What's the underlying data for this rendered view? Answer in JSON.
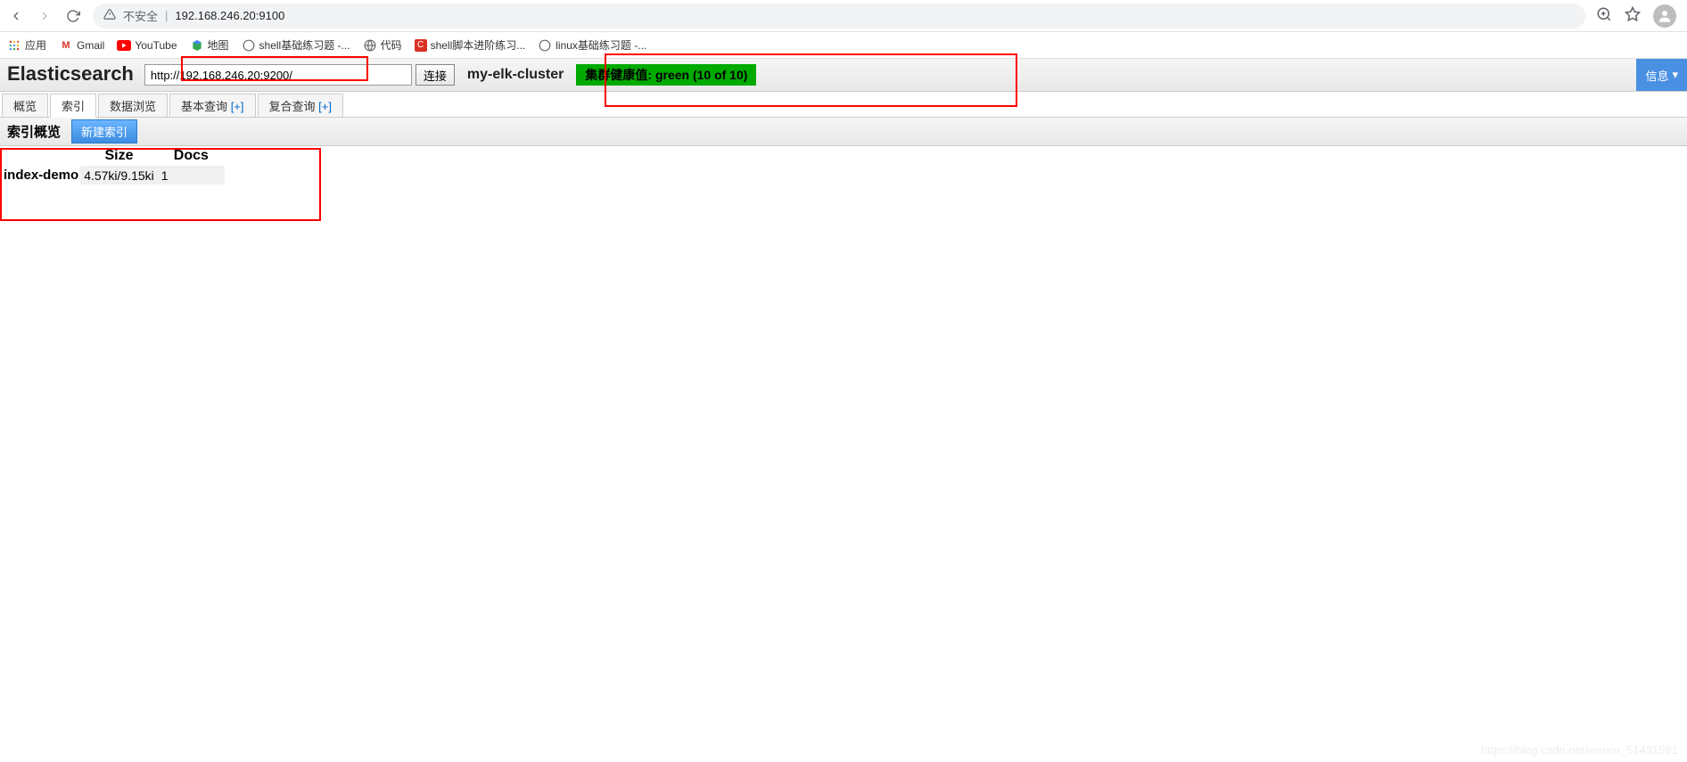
{
  "browser": {
    "url_security": "不安全",
    "url": "192.168.246.20:9100"
  },
  "bookmarks": {
    "apps": "应用",
    "items": [
      {
        "label": "Gmail"
      },
      {
        "label": "YouTube"
      },
      {
        "label": "地图"
      },
      {
        "label": "shell基础练习题 -..."
      },
      {
        "label": "代码"
      },
      {
        "label": "shell脚本进阶练习..."
      },
      {
        "label": "linux基础练习题 -..."
      }
    ]
  },
  "es": {
    "logo": "Elasticsearch",
    "url_value": "http://192.168.246.20:9200/",
    "connect": "连接",
    "cluster_name": "my-elk-cluster",
    "health_text": "集群健康值: green (10 of 10)",
    "info_btn": "信息"
  },
  "tabs": {
    "overview": "概览",
    "indices": "索引",
    "browse": "数据浏览",
    "basic_query": "基本查询",
    "compound_query": "复合查询",
    "plus": "[+]"
  },
  "index_panel": {
    "title": "索引概览",
    "new_index": "新建索引",
    "headers": {
      "size": "Size",
      "docs": "Docs"
    },
    "rows": [
      {
        "name": "index-demo",
        "size": "4.57ki/9.15ki",
        "docs": "1"
      }
    ]
  },
  "watermark": "https://blog.csdn.net/weixin_51431591"
}
